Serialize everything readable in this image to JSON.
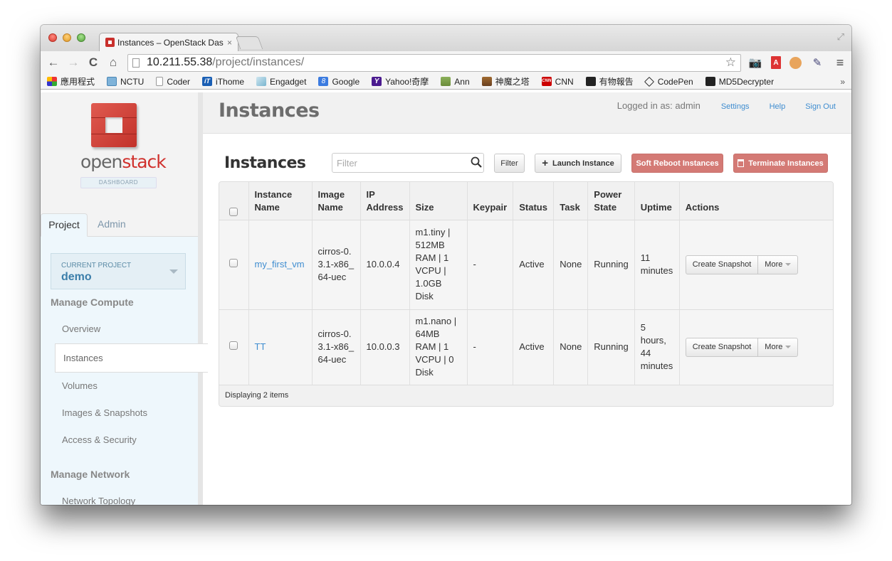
{
  "browser": {
    "tab_title": "Instances – OpenStack Das",
    "tab_close": "×",
    "url_host": "10.211.55.38",
    "url_path": "/project/instances/",
    "nav": {
      "back": "←",
      "forward": "→",
      "reload": "C",
      "home": "⌂",
      "star": "☆",
      "menu": "≡",
      "fullscreen": "⤢"
    },
    "bookmarks": [
      {
        "label": "應用程式",
        "icon": "apps-grid-icon"
      },
      {
        "label": "NCTU",
        "icon": "folder-icon"
      },
      {
        "label": "Coder",
        "icon": "page-icon"
      },
      {
        "label": "iThome",
        "icon": "ithome-icon"
      },
      {
        "label": "Engadget",
        "icon": "rss-icon"
      },
      {
        "label": "Google",
        "icon": "google-icon"
      },
      {
        "label": "Yahoo!奇摩",
        "icon": "yahoo-icon"
      },
      {
        "label": "Ann",
        "icon": "photo-icon"
      },
      {
        "label": "神魔之塔",
        "icon": "game-icon"
      },
      {
        "label": "CNN",
        "icon": "cnn-icon"
      },
      {
        "label": "有物報告",
        "icon": "news-icon"
      },
      {
        "label": "CodePen",
        "icon": "codepen-icon"
      },
      {
        "label": "MD5Decrypter",
        "icon": "md5-icon"
      }
    ],
    "bookmarks_more": "»"
  },
  "sidebar": {
    "logo_open": "open",
    "logo_stack": "stack",
    "logo_sub": "DASHBOARD",
    "tabs": [
      {
        "label": "Project",
        "active": true
      },
      {
        "label": "Admin",
        "active": false
      }
    ],
    "current_project_label": "CURRENT PROJECT",
    "current_project": "demo",
    "sections": [
      {
        "heading": "Manage Compute",
        "items": [
          "Overview",
          "Instances",
          "Volumes",
          "Images & Snapshots",
          "Access & Security"
        ]
      },
      {
        "heading": "Manage Network",
        "items": [
          "Network Topology"
        ]
      }
    ],
    "active_item": "Instances"
  },
  "header": {
    "title": "Instances",
    "logged_in": "Logged in as: admin",
    "links": [
      "Settings",
      "Help",
      "Sign Out"
    ]
  },
  "table": {
    "title": "Instances",
    "filter_placeholder": "Filter",
    "filter_button": "Filter",
    "launch_button": "Launch Instance",
    "launch_icon": "+",
    "reboot_button": "Soft Reboot Instances",
    "terminate_button": "Terminate Instances",
    "columns": [
      "Instance Name",
      "Image Name",
      "IP Address",
      "Size",
      "Keypair",
      "Status",
      "Task",
      "Power State",
      "Uptime",
      "Actions"
    ],
    "rows": [
      {
        "name": "my_first_vm",
        "image": "cirros-0.3.1-x86_64-uec",
        "ip": "10.0.0.4",
        "size": "m1.tiny | 512MB RAM | 1 VCPU | 1.0GB Disk",
        "keypair": "-",
        "status": "Active",
        "task": "None",
        "power": "Running",
        "uptime": "11 minutes",
        "action_primary": "Create Snapshot",
        "action_more": "More"
      },
      {
        "name": "TT",
        "image": "cirros-0.3.1-x86_64-uec",
        "ip": "10.0.0.3",
        "size": "m1.nano | 64MB RAM | 1 VCPU | 0 Disk",
        "keypair": "-",
        "status": "Active",
        "task": "None",
        "power": "Running",
        "uptime": "5 hours, 44 minutes",
        "action_primary": "Create Snapshot",
        "action_more": "More"
      }
    ],
    "footer": "Displaying 2 items"
  },
  "colors": {
    "accent": "#3f8dd0",
    "danger": "#d47a75",
    "brand": "#d0312d",
    "sidebar_bg": "#eef7fc"
  }
}
